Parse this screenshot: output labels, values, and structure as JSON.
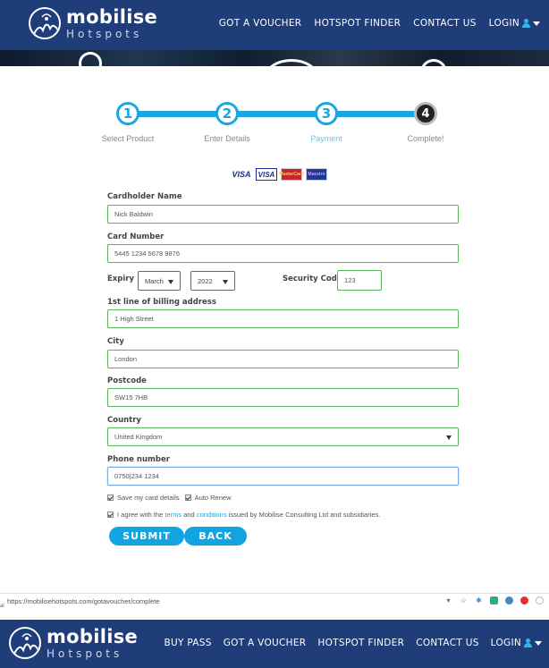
{
  "nav": {
    "logo_name": "mobilise",
    "logo_sub": "Hotspots",
    "links": [
      "GOT A VOUCHER",
      "HOTSPOT FINDER",
      "CONTACT US",
      "LOGIN"
    ]
  },
  "progress": {
    "steps": [
      {
        "number": "1",
        "label": "Select Product"
      },
      {
        "number": "2",
        "label": "Enter Details"
      },
      {
        "number": "3",
        "label": "Payment"
      },
      {
        "number": "4",
        "label": "Complete!"
      }
    ]
  },
  "cards": [
    "VISA",
    "VISA",
    "MasterCard",
    "Maestro"
  ],
  "form": {
    "cardholder_label": "Cardholder Name",
    "cardholder_value": "Nick Baldwin",
    "card_number_label": "Card Number",
    "card_number_value": "5445 1234 5678 9876",
    "expiry_label": "Expiry",
    "expiry_month": "March",
    "expiry_year": "2022",
    "security_label": "Security Code",
    "security_value": "123",
    "address_label": "1st line of billing address",
    "address_value": "1 High Street",
    "city_label": "City",
    "city_value": "London",
    "postcode_label": "Postcode",
    "postcode_value": "SW15 7HB",
    "country_label": "Country",
    "country_value": "United Kingdom",
    "phone_label": "Phone number",
    "phone_value": "0750|234 1234",
    "save_card": "Save my card details",
    "auto_renew": "Auto Renew",
    "agree_prefix": "I agree with the",
    "agree_terms": "terms",
    "agree_and": "and",
    "agree_conditions": "conditions",
    "agree_suffix": "issued by Mobilise Consulting Ltd and subsidiaries.",
    "submit": "SUBMIT",
    "back": "BACK"
  },
  "status": {
    "url": "https://mobilisehotspots.com/gotavoucher/complete",
    "mark": "al"
  },
  "bottom_nav": {
    "logo_name": "mobilise",
    "logo_sub": "Hotspots",
    "links": [
      "BUY PASS",
      "GOT A VOUCHER",
      "HOTSPOT FINDER",
      "CONTACT US",
      "LOGIN"
    ]
  },
  "colors": {
    "nav_bg": "#1f3d78",
    "accent": "#1aa6e0",
    "field_border": "#5cb35c",
    "button": "#12a3e3"
  }
}
